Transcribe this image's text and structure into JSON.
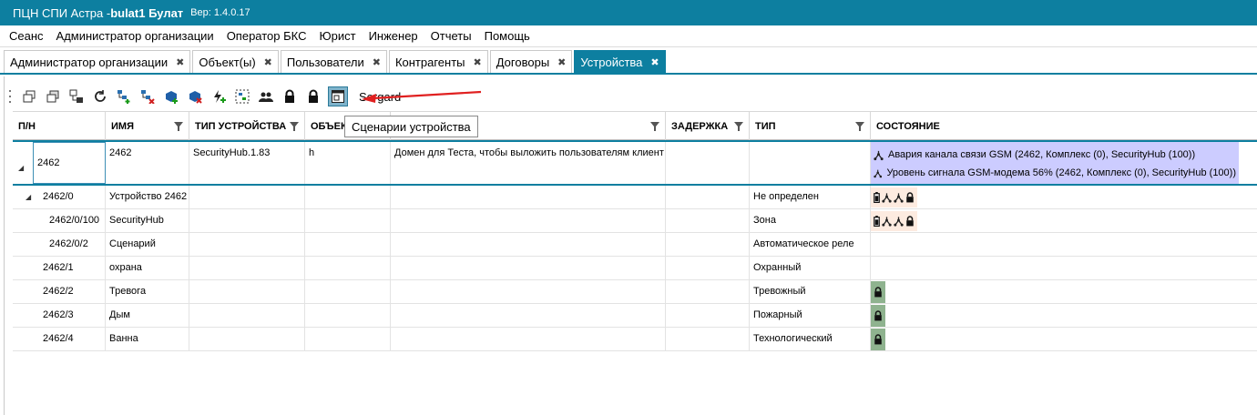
{
  "title": {
    "prefix": "ПЦН СПИ Астра - ",
    "user": "bulat1 Булат",
    "version": "Вер: 1.4.0.17"
  },
  "menu": [
    "Сеанс",
    "Администратор организации",
    "Оператор БКС",
    "Юрист",
    "Инженер",
    "Отчеты",
    "Помощь"
  ],
  "tabs": [
    {
      "label": "Администратор организации",
      "active": false
    },
    {
      "label": "Объект(ы)",
      "active": false
    },
    {
      "label": "Пользователи",
      "active": false
    },
    {
      "label": "Контрагенты",
      "active": false
    },
    {
      "label": "Договоры",
      "active": false
    },
    {
      "label": "Устройства",
      "active": true
    }
  ],
  "toolbar": {
    "search_text": "Sergard",
    "tooltip": "Сценарии устройства",
    "icons": [
      "copy-window-icon",
      "copy-window-icon",
      "device-tree-icon",
      "refresh-icon",
      "add-node-icon",
      "remove-node-icon",
      "add-device-icon",
      "remove-device-icon",
      "lightning-add-icon",
      "select-nodes-icon",
      "users-icon",
      "lock-icon",
      "lock-icon",
      "scenario-icon"
    ]
  },
  "columns": [
    {
      "label": "П/Н",
      "filter": false
    },
    {
      "label": "ИМЯ",
      "filter": true
    },
    {
      "label": "ТИП УСТРОЙСТВА",
      "filter": true
    },
    {
      "label": "ОБЪЕКТ",
      "filter": false
    },
    {
      "label": "",
      "filter": true
    },
    {
      "label": "ЗАДЕРЖКА",
      "filter": true
    },
    {
      "label": "ТИП",
      "filter": true
    },
    {
      "label": "СОСТОЯНИЕ",
      "filter": false
    }
  ],
  "parent_row": {
    "pn": "2462",
    "name": "2462",
    "device_type": "SecurityHub.1.83",
    "object": "h",
    "description": "Домен для Теста, чтобы выложить пользователям клиент",
    "state": [
      "Авария канала связи GSM (2462, Комплекс (0), SecurityHub (100))",
      "Уровень сигнала GSM-модема 56% (2462, Комплекс (0), SecurityHub (100))"
    ]
  },
  "child_rows": [
    {
      "pn": "2462/0",
      "name": "Устройство 2462",
      "type": "Не определен",
      "indent": 1,
      "expander": true,
      "state": "icons"
    },
    {
      "pn": "2462/0/100",
      "name": "SecurityHub",
      "type": "Зона",
      "indent": 2,
      "expander": false,
      "state": "icons"
    },
    {
      "pn": "2462/0/2",
      "name": "Сценарий",
      "type": "Автоматическое реле",
      "indent": 2,
      "expander": false,
      "state": "none"
    },
    {
      "pn": "2462/1",
      "name": "охрана",
      "type": "Охранный",
      "indent": 1,
      "expander": false,
      "state": "none"
    },
    {
      "pn": "2462/2",
      "name": "Тревога",
      "type": "Тревожный",
      "indent": 1,
      "expander": false,
      "state": "lock"
    },
    {
      "pn": "2462/3",
      "name": "Дым",
      "type": "Пожарный",
      "indent": 1,
      "expander": false,
      "state": "lock"
    },
    {
      "pn": "2462/4",
      "name": "Ванна",
      "type": "Технологический",
      "indent": 1,
      "expander": false,
      "state": "lock"
    }
  ],
  "colors": {
    "accent": "#0d7fa0",
    "state_highlight": "#ccccff",
    "lock_bg": "#8fb38f",
    "icons_bg": "#fdebe0",
    "arrow": "#e02020"
  }
}
